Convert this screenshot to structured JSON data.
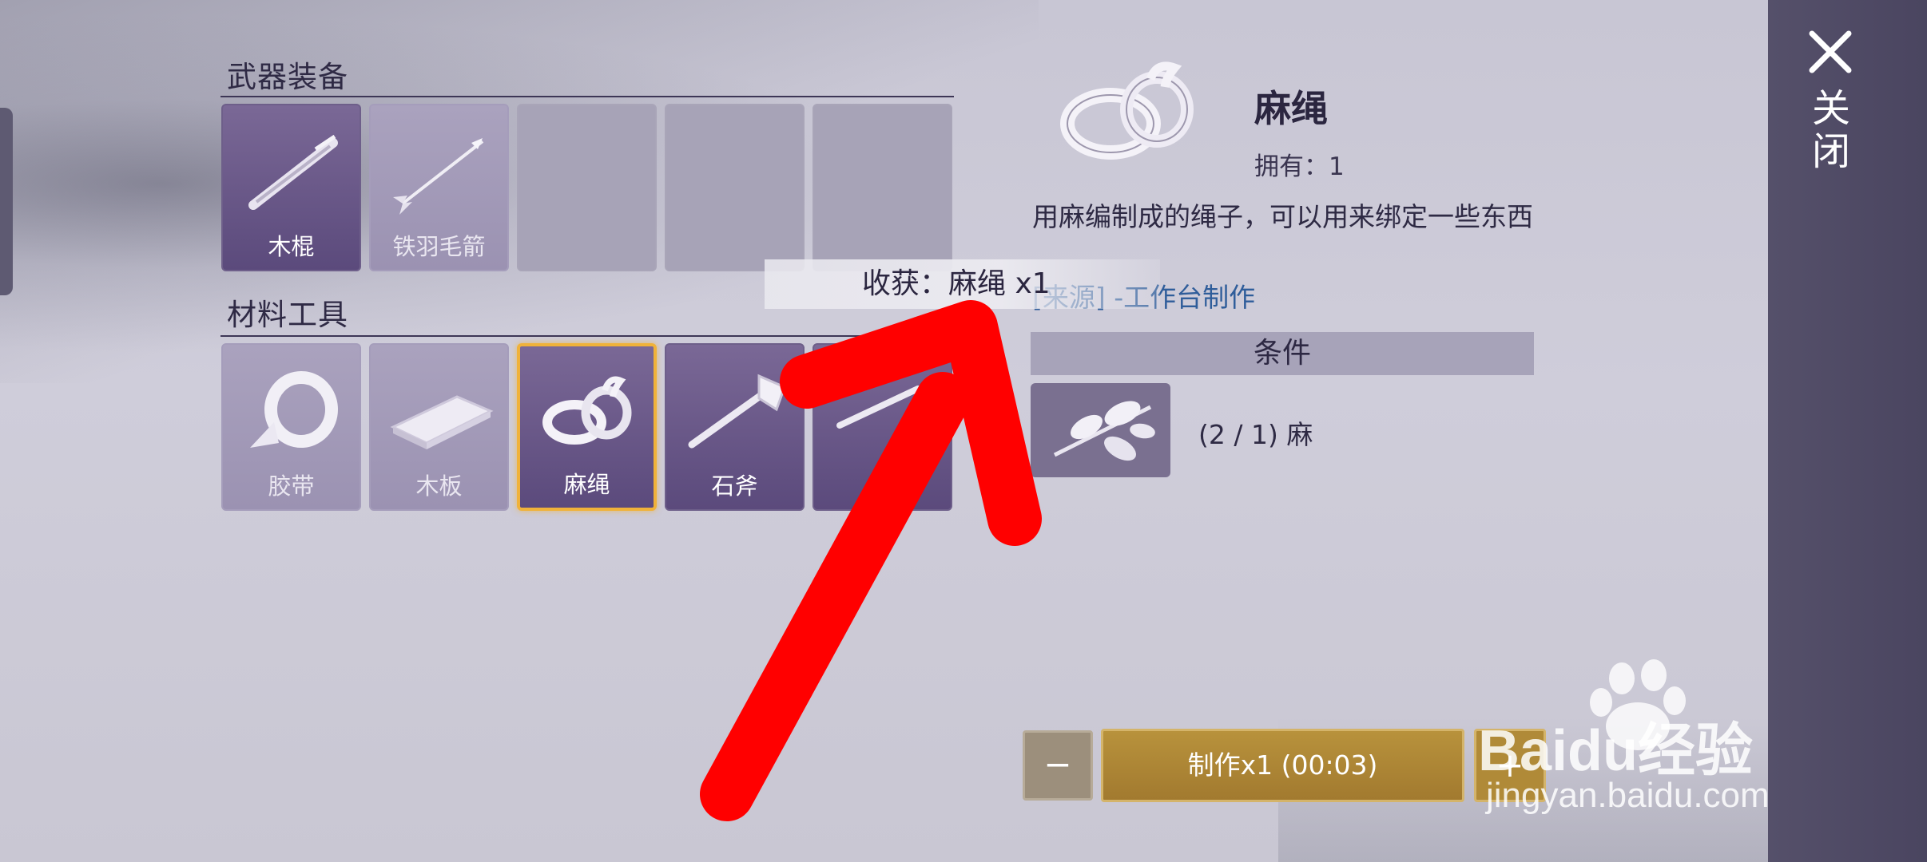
{
  "weapons_section": {
    "title": "武器装备",
    "items": [
      {
        "label": "木棍",
        "icon": "wooden-stick-icon",
        "state": "available"
      },
      {
        "label": "铁羽毛箭",
        "icon": "arrow-icon",
        "state": "dim"
      },
      {
        "label": "",
        "state": "empty"
      },
      {
        "label": "",
        "state": "empty"
      },
      {
        "label": "",
        "state": "empty"
      }
    ]
  },
  "materials_section": {
    "title": "材料工具",
    "items": [
      {
        "label": "胶带",
        "icon": "tape-icon",
        "state": "dim"
      },
      {
        "label": "木板",
        "icon": "plank-icon",
        "state": "dim"
      },
      {
        "label": "麻绳",
        "icon": "rope-icon",
        "state": "selected"
      },
      {
        "label": "石斧",
        "icon": "stone-axe-icon",
        "state": "available"
      },
      {
        "label": "",
        "icon": "unknown-item-icon",
        "state": "available"
      }
    ]
  },
  "detail": {
    "name": "麻绳",
    "owned": "拥有：1",
    "description": "用麻编制成的绳子，可以用来绑定一些东西",
    "source": "[来源] -工作台制作",
    "conditions_title": "条件",
    "requirement": "(2 / 1) 麻",
    "requirement_icon": "hemp-leaf-icon"
  },
  "notification": {
    "text": "收获：麻绳 x1"
  },
  "controls": {
    "minus": "−",
    "make": "制作x1 (00:03)",
    "plus": "+"
  },
  "close": {
    "label": "关闭"
  },
  "watermark": {
    "logo": "Baidu经验",
    "url": "jingyan.baidu.com"
  },
  "colors": {
    "accent_gold": "#b8923c",
    "selected_border": "#f0b23a",
    "slot_purple": "#5b4a7c",
    "panel_dark": "#4a4560",
    "arrow_red": "#ff0000",
    "source_link": "#2f5d9a"
  }
}
